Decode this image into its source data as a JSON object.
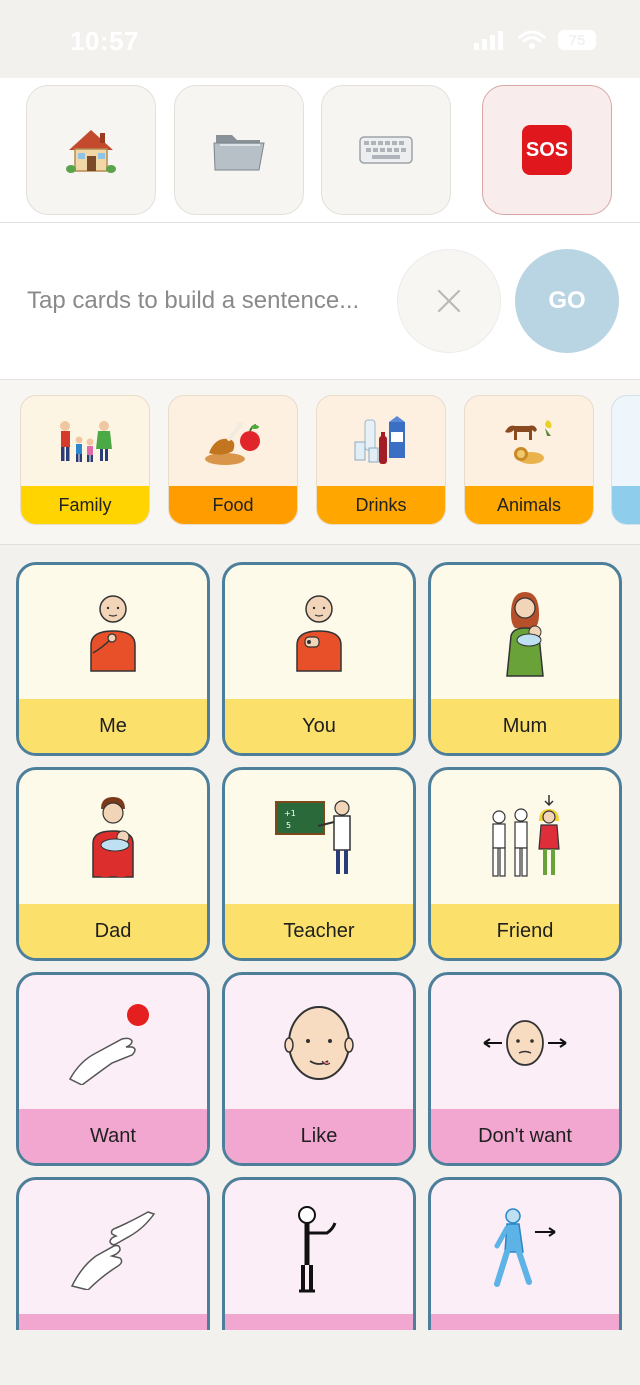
{
  "status": {
    "time": "10:57",
    "battery": "75"
  },
  "toolbar": {
    "items": [
      {
        "name": "home-button",
        "icon": "house-icon"
      },
      {
        "name": "folder-button",
        "icon": "folder-icon"
      },
      {
        "name": "keyboard-button",
        "icon": "keyboard-icon"
      },
      {
        "name": "sos-button",
        "icon": "sos-icon",
        "label": "SOS"
      }
    ]
  },
  "sentence": {
    "placeholder": "Tap cards to build a sentence...",
    "go_label": "GO"
  },
  "categories": [
    {
      "label": "Family",
      "color": "#ffd400"
    },
    {
      "label": "Food",
      "color": "#ff9d00"
    },
    {
      "label": "Drinks",
      "color": "#ffa600"
    },
    {
      "label": "Animals",
      "color": "#ffa800"
    }
  ],
  "cards": [
    {
      "label": "Me",
      "theme": "yellow",
      "icon": "person-pointing-self-icon"
    },
    {
      "label": "You",
      "theme": "yellow",
      "icon": "person-pointing-you-icon"
    },
    {
      "label": "Mum",
      "theme": "yellow",
      "icon": "mother-with-baby-icon"
    },
    {
      "label": "Dad",
      "theme": "yellow",
      "icon": "father-with-baby-icon"
    },
    {
      "label": "Teacher",
      "theme": "yellow",
      "icon": "teacher-at-board-icon"
    },
    {
      "label": "Friend",
      "theme": "yellow",
      "icon": "group-of-friends-icon"
    },
    {
      "label": "Want",
      "theme": "pink",
      "icon": "hand-reaching-ball-icon"
    },
    {
      "label": "Like",
      "theme": "pink",
      "icon": "face-licking-lips-icon"
    },
    {
      "label": "Don't want",
      "theme": "pink",
      "icon": "face-shaking-head-icon"
    },
    {
      "label": "",
      "theme": "pink",
      "icon": "hands-giving-icon"
    },
    {
      "label": "",
      "theme": "pink",
      "icon": "person-stop-icon"
    },
    {
      "label": "",
      "theme": "pink",
      "icon": "person-walking-away-icon"
    }
  ],
  "colors": {
    "card_border": "#4d7f9a",
    "yellow_band": "#fbe06b",
    "pink_band": "#f2a7d0",
    "go_button": "#b9d4e3"
  }
}
